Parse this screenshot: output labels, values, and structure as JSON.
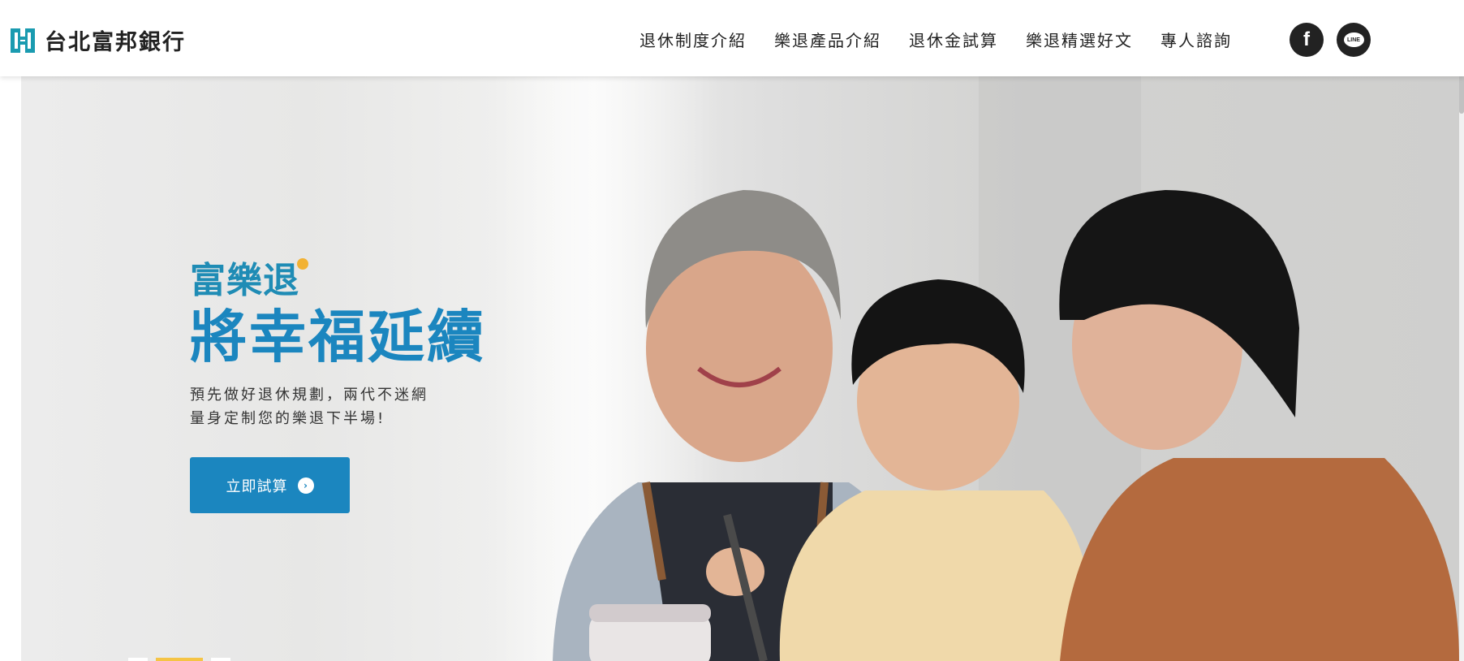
{
  "header": {
    "logo_text": "台北富邦銀行",
    "nav": [
      {
        "label": "退休制度介紹"
      },
      {
        "label": "樂退產品介紹"
      },
      {
        "label": "退休金試算"
      },
      {
        "label": "樂退精選好文"
      },
      {
        "label": "專人諮詢"
      }
    ],
    "social": [
      {
        "icon": "facebook-icon",
        "glyph": "f"
      },
      {
        "icon": "line-icon",
        "glyph": "LINE"
      }
    ]
  },
  "hero": {
    "brand": "富樂退",
    "headline": "將幸福延續",
    "sub_line_1": "預先做好退休規劃，兩代不迷網",
    "sub_line_2": "量身定制您的樂退下半場!",
    "cta_label": "立即試算",
    "cta_icon": "chevron-right-circle-icon",
    "slides": 3,
    "active_slide": 2
  },
  "colors": {
    "brand_blue": "#1b86bf",
    "logo_teal": "#1a9bb0",
    "accent_yellow": "#f5c445",
    "nav_text": "#222222"
  }
}
